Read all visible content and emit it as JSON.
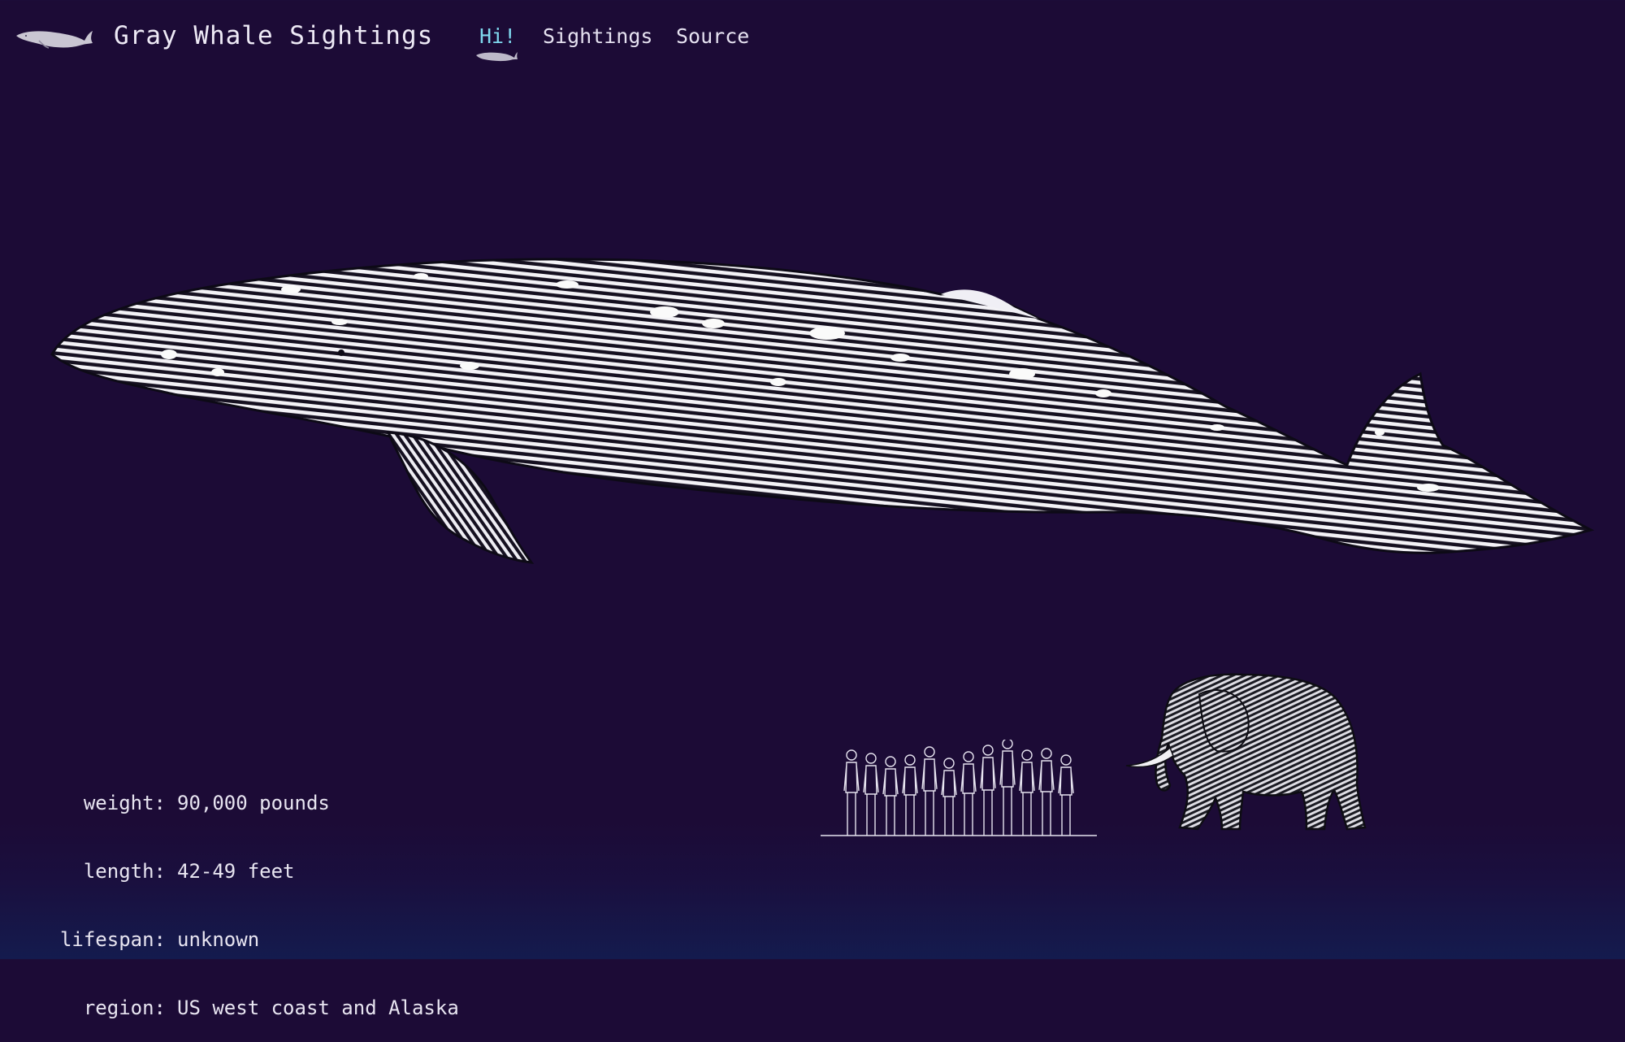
{
  "header": {
    "site_title": "Gray Whale Sightings",
    "logo_icon": "gray-whale-logo-icon",
    "nav": [
      {
        "label": "Hi!",
        "active": true
      },
      {
        "label": "Sightings",
        "active": false
      },
      {
        "label": "Source",
        "active": false
      }
    ],
    "active_indicator_icon": "small-whale-icon"
  },
  "hero": {
    "illustration": "gray-whale-engraving-illustration"
  },
  "stats": [
    {
      "label": "weight:",
      "value": "90,000 pounds"
    },
    {
      "label": "length:",
      "value": "42-49 feet"
    },
    {
      "label": "lifespan:",
      "value": "unknown"
    },
    {
      "label": "region:",
      "value": "US west coast and Alaska"
    }
  ],
  "comparison": {
    "people_illustration": "line-of-people-illustration",
    "elephant_illustration": "elephant-engraving-illustration"
  },
  "colors": {
    "background": "#1c0b36",
    "background_bottom": "#141b4e",
    "text": "#e9e6f2",
    "active_nav": "#7fd9ee"
  }
}
